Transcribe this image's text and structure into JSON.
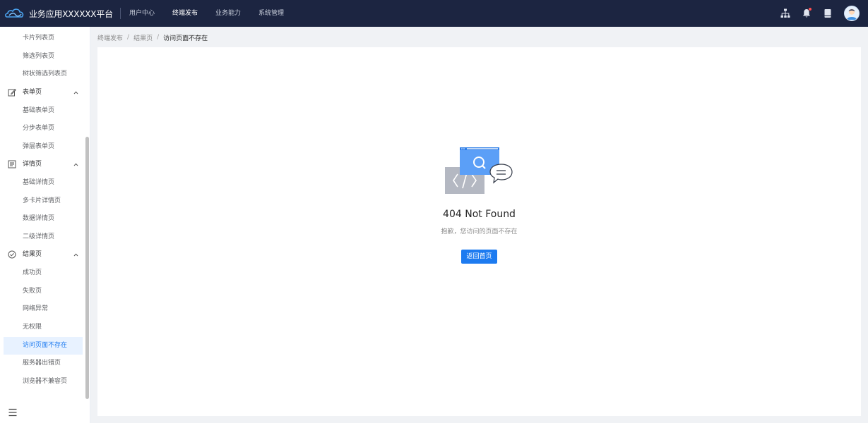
{
  "header": {
    "app_title": "业务应用XXXXXX平台",
    "nav": [
      {
        "label": "用户中心",
        "active": false
      },
      {
        "label": "终端发布",
        "active": true
      },
      {
        "label": "业务能力",
        "active": false
      },
      {
        "label": "系统管理",
        "active": false
      }
    ],
    "icons": [
      "sitemap-icon",
      "bell-icon",
      "book-icon"
    ],
    "colors": {
      "header_bg": "#1c2541",
      "accent": "#1d7bf0",
      "notification_dot": "#ff4d4f"
    }
  },
  "sidebar": {
    "list_items": [
      "卡片列表页",
      "筛选列表页",
      "树状筛选列表页"
    ],
    "form_group": {
      "label": "表单页",
      "items": [
        "基础表单页",
        "分步表单页",
        "弹层表单页"
      ]
    },
    "detail_group": {
      "label": "详情页",
      "items": [
        "基础详情页",
        "多卡片详情页",
        "数据详情页",
        "二级详情页"
      ]
    },
    "result_group": {
      "label": "结果页",
      "items": [
        "成功页",
        "失败页",
        "网络异常",
        "无权限",
        "访问页面不存在",
        "服务器出错页",
        "浏览器不兼容页"
      ],
      "active_index": 4
    }
  },
  "breadcrumb": {
    "items": [
      "终端发布",
      "结果页"
    ],
    "current": "访问页面不存在",
    "separator": "/"
  },
  "result": {
    "title": "404 Not Found",
    "subtitle": "抱歉，您访问的页面不存在",
    "button_label": "返回首页"
  }
}
